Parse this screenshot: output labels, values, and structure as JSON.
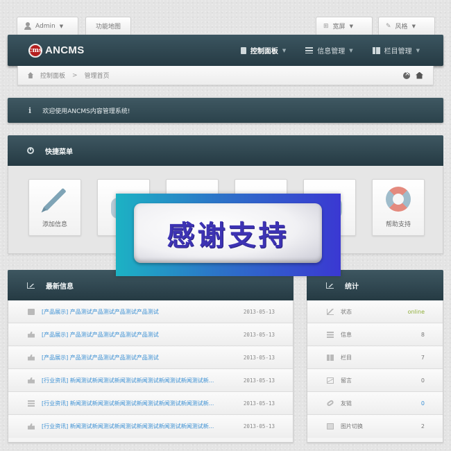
{
  "topbar": {
    "user_label": "Admin",
    "sitemap_label": "功能地图",
    "wide_label": "宽屏",
    "style_label": "风格"
  },
  "nav": {
    "logo_mark": "cms",
    "logo_text": "ANCMS",
    "items": [
      {
        "label": "控制面板",
        "icon": "clipboard-icon",
        "active": true
      },
      {
        "label": "信息管理",
        "icon": "list-icon",
        "active": false
      },
      {
        "label": "栏目管理",
        "icon": "columns-icon",
        "active": false
      }
    ]
  },
  "breadcrumb": {
    "root": "控制面板",
    "separator": ">",
    "current": "管理首页"
  },
  "welcome": {
    "text": "欢迎使用ANCMS内容管理系统!"
  },
  "quick_menu": {
    "title": "快捷菜单",
    "tiles": [
      {
        "label": "添加信息",
        "icon": "pen-icon"
      },
      {
        "label": "",
        "icon": "chat-icon"
      },
      {
        "label": "",
        "icon": "people-icon"
      },
      {
        "label": "",
        "icon": "monitor-icon"
      },
      {
        "label": "",
        "icon": "user-icon"
      },
      {
        "label": "帮助支持",
        "icon": "lifebuoy-icon"
      }
    ]
  },
  "overlay": {
    "text": "感谢支持"
  },
  "news": {
    "title": "最新信息",
    "rows": [
      {
        "title": "[产品展示] 产品测试产品测试产品测试产品测试",
        "date": "2013-05-13",
        "icon": "message-icon"
      },
      {
        "title": "[产品展示] 产品测试产品测试产品测试产品测试",
        "date": "2013-05-13",
        "icon": "thumb-icon"
      },
      {
        "title": "[产品展示] 产品测试产品测试产品测试产品测试",
        "date": "2013-05-13",
        "icon": "thumb-icon"
      },
      {
        "title": "[行业资讯] 新闻测试新闻测试新闻测试新闻测试新闻测试新闻测试新...",
        "date": "2013-05-13",
        "icon": "thumb-icon"
      },
      {
        "title": "[行业资讯] 新闻测试新闻测试新闻测试新闻测试新闻测试新闻测试新...",
        "date": "2013-05-13",
        "icon": "list-icon"
      },
      {
        "title": "[行业资讯] 新闻测试新闻测试新闻测试新闻测试新闻测试新闻测试新...",
        "date": "2013-05-13",
        "icon": "thumb-icon"
      }
    ]
  },
  "stats": {
    "title": "统计",
    "rows": [
      {
        "label": "状态",
        "value": "online",
        "icon": "chart-icon"
      },
      {
        "label": "信息",
        "value": "8",
        "icon": "list-icon"
      },
      {
        "label": "栏目",
        "value": "7",
        "icon": "grid-icon"
      },
      {
        "label": "留言",
        "value": "0",
        "icon": "mail-icon"
      },
      {
        "label": "友链",
        "value": "0",
        "icon": "link-icon"
      },
      {
        "label": "图片切换",
        "value": "2",
        "icon": "image-icon"
      }
    ]
  },
  "colors": {
    "nav_bg": "#2b424b",
    "link": "#3a8fd3",
    "online": "#8fae3a",
    "overlay_text": "#3d33b4"
  }
}
